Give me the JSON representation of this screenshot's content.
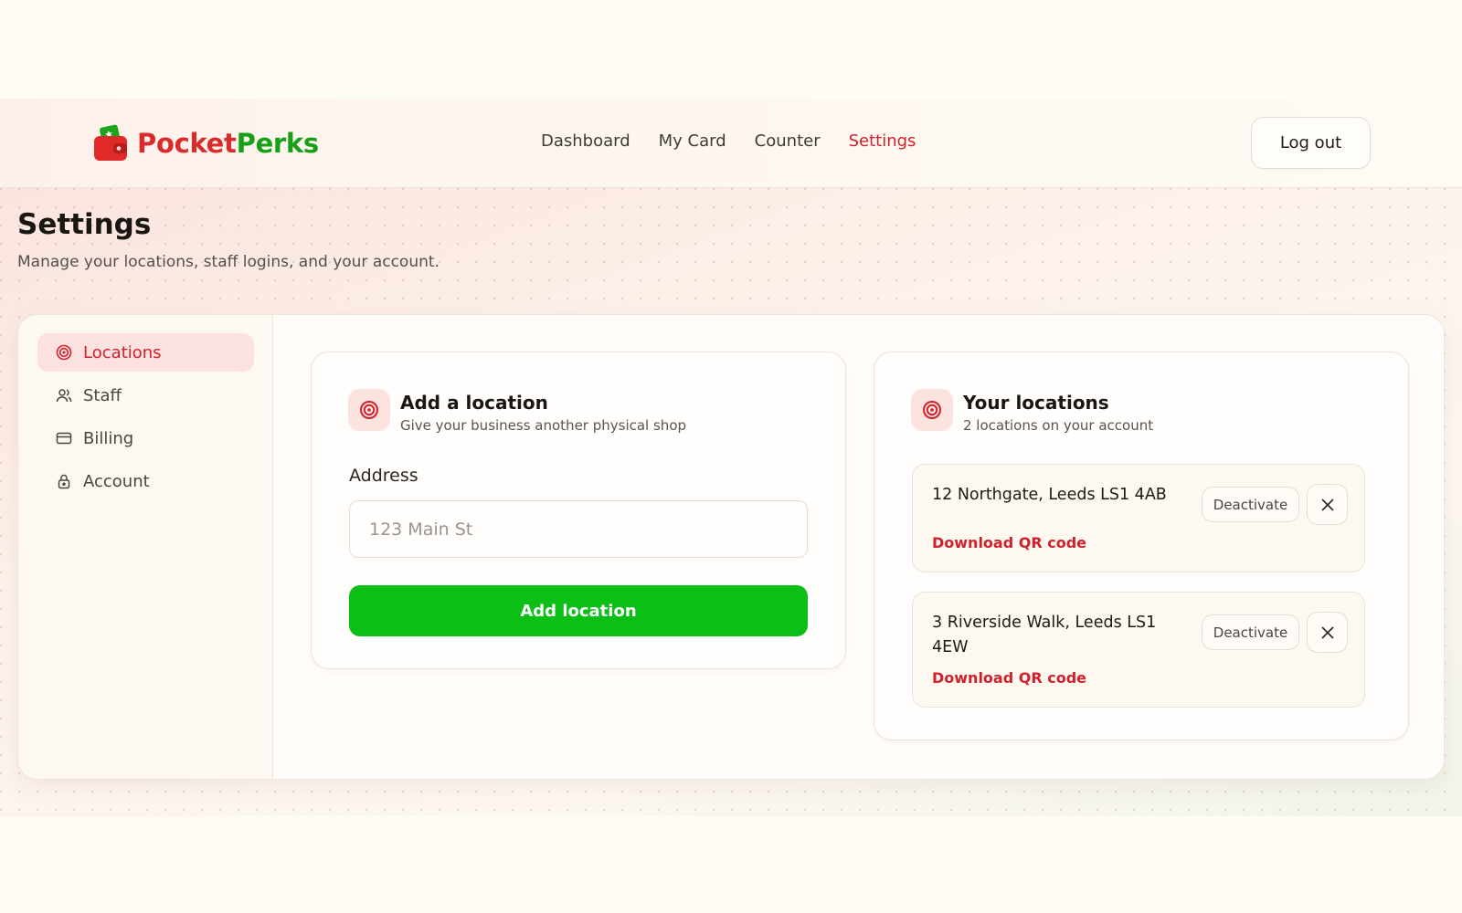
{
  "brand": {
    "name_part1": "Pocket",
    "name_part2": "Perks"
  },
  "nav": {
    "items": [
      {
        "label": "Dashboard",
        "active": false
      },
      {
        "label": "My Card",
        "active": false
      },
      {
        "label": "Counter",
        "active": false
      },
      {
        "label": "Settings",
        "active": true
      }
    ],
    "logout_label": "Log out"
  },
  "page": {
    "title": "Settings",
    "subtitle": "Manage your locations, staff logins, and your account."
  },
  "sidebar": {
    "items": [
      {
        "label": "Locations",
        "icon": "target-icon",
        "active": true
      },
      {
        "label": "Staff",
        "icon": "users-icon",
        "active": false
      },
      {
        "label": "Billing",
        "icon": "credit-card-icon",
        "active": false
      },
      {
        "label": "Account",
        "icon": "lock-icon",
        "active": false
      }
    ]
  },
  "add_location": {
    "title": "Add a location",
    "subtitle": "Give your business another physical shop",
    "address_label": "Address",
    "address_placeholder": "123 Main St",
    "address_value": "",
    "submit_label": "Add location"
  },
  "your_locations": {
    "title": "Your locations",
    "subtitle": "2 locations on your account",
    "items": [
      {
        "address": "12 Northgate, Leeds LS1 4AB",
        "deactivate_label": "Deactivate",
        "qr_label": "Download QR code"
      },
      {
        "address": "3 Riverside Walk, Leeds LS1 4EW",
        "deactivate_label": "Deactivate",
        "qr_label": "Download QR code"
      }
    ]
  },
  "colors": {
    "accent_red": "#d2202c",
    "brand_green": "#15a018",
    "button_green": "#0cbf17",
    "active_bg": "#fbe1df",
    "page_bg": "#fffbf5"
  }
}
